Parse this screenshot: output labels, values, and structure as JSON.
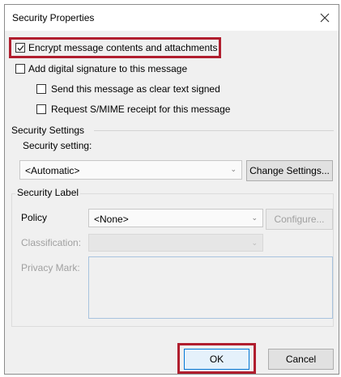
{
  "window": {
    "title": "Security Properties"
  },
  "options": {
    "encrypt": {
      "label": "Encrypt message contents and attachments",
      "checked": true
    },
    "sign": {
      "label": "Add digital signature to this message",
      "checked": false
    },
    "clear_text": {
      "label": "Send this message as clear text signed",
      "checked": false
    },
    "receipt": {
      "label": "Request S/MIME receipt for this message",
      "checked": false
    }
  },
  "security_settings": {
    "section_label": "Security Settings",
    "field_label": "Security setting:",
    "selected_value": "<Automatic>",
    "change_button": "Change Settings..."
  },
  "security_label": {
    "section_label": "Security Label",
    "policy_label": "Policy",
    "policy_value": "<None>",
    "configure_button": "Configure...",
    "classification_label": "Classification:",
    "privacy_mark_label": "Privacy Mark:"
  },
  "buttons": {
    "ok": "OK",
    "cancel": "Cancel"
  },
  "colors": {
    "highlight": "#b01e2e",
    "dialog_bg": "#f0f0f0"
  }
}
